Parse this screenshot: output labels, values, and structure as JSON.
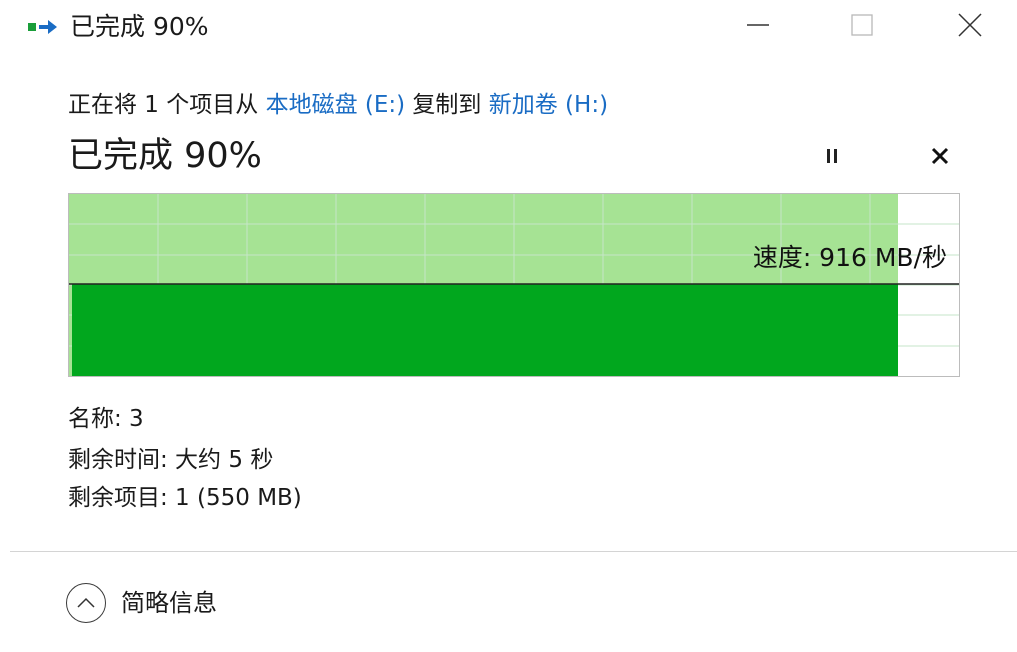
{
  "window": {
    "title": "已完成 90%",
    "icons": {
      "app": "copy-files-icon",
      "minimize": "minimize-icon",
      "maximize": "maximize-icon",
      "close": "close-icon"
    }
  },
  "copy": {
    "prefix": "正在将 1 个项目从 ",
    "source": "本地磁盘 (E:)",
    "middle": " 复制到 ",
    "destination": "新加卷 (H:)"
  },
  "progress": {
    "status": "已完成 90%",
    "percent": 90,
    "pause_icon": "pause-icon",
    "cancel_icon": "cancel-icon"
  },
  "graph": {
    "speed_text": "速度: 916 MB/秒",
    "colors": {
      "completed_area": "#a6e394",
      "speed_area": "#01a71e",
      "grid": "#c6e6c8"
    }
  },
  "details": {
    "name_label": "名称: 3",
    "time_remaining": "剩余时间: 大约 5 秒",
    "items_remaining": "剩余项目: 1 (550 MB)"
  },
  "footer": {
    "toggle_label": "简略信息",
    "toggle_icon": "chevron-up-icon"
  }
}
